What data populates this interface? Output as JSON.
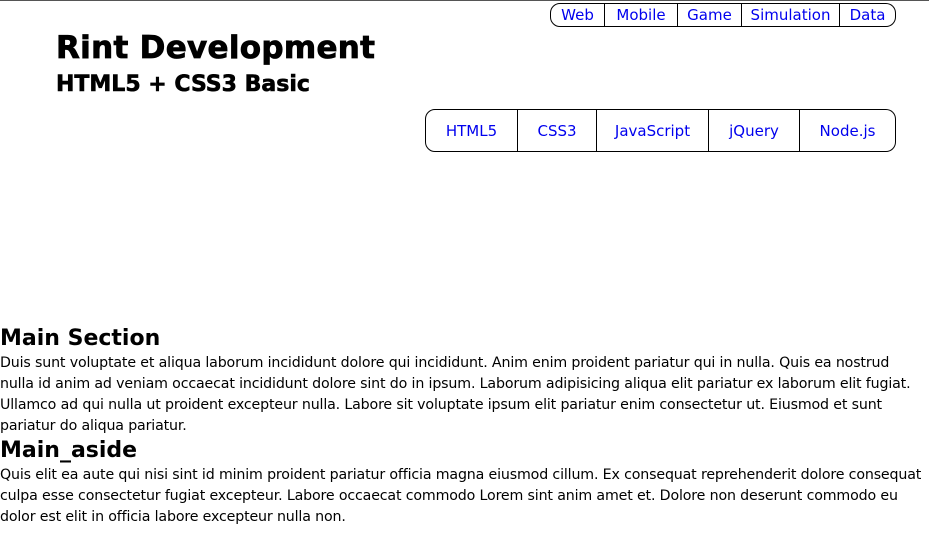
{
  "top_nav": {
    "items": [
      "Web",
      "Mobile",
      "Game",
      "Simulation",
      "Data"
    ]
  },
  "header": {
    "title": "Rint Development",
    "subtitle": "HTML5 + CSS3 Basic"
  },
  "main_nav": {
    "items": [
      "HTML5",
      "CSS3",
      "JavaScript",
      "jQuery",
      "Node.js"
    ]
  },
  "main_section": {
    "heading": "Main Section",
    "text": "Duis sunt voluptate et aliqua laborum incididunt dolore qui incididunt. Anim enim proident pariatur qui in nulla. Quis ea nostrud nulla id anim ad veniam occaecat incididunt dolore sint do in ipsum. Laborum adipisicing aliqua elit pariatur ex laborum elit fugiat. Ullamco ad qui nulla ut proident excepteur nulla. Labore sit voluptate ipsum elit pariatur enim consectetur ut. Eiusmod et sunt pariatur do aliqua pariatur."
  },
  "main_aside": {
    "heading": "Main_aside",
    "text": "Quis elit ea aute qui nisi sint id minim proident pariatur officia magna eiusmod cillum. Ex consequat reprehenderit dolore consequat culpa esse consectetur fugiat excepteur. Labore occaecat commodo Lorem sint anim amet et. Dolore non deserunt commodo eu dolor est elit in officia labore excepteur nulla non."
  }
}
